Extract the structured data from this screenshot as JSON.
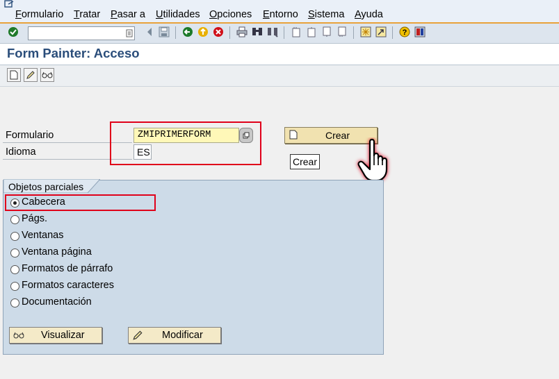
{
  "menu": {
    "items": [
      "Formulario",
      "Tratar",
      "Pasar a",
      "Utilidades",
      "Opciones",
      "Entorno",
      "Sistema",
      "Ayuda"
    ],
    "underline": [
      "F",
      "T",
      "P",
      "U",
      "O",
      "E",
      "S",
      "A"
    ]
  },
  "toolbar": {
    "command_value": ""
  },
  "page_title": "Form Painter: Acceso",
  "fields": {
    "form_label": "Formulario",
    "form_value": "ZMIPRIMERFORM",
    "lang_label": "Idioma",
    "lang_value": "ES"
  },
  "create_button": {
    "label": "Crear",
    "tooltip": "Crear"
  },
  "group": {
    "title": "Objetos parciales",
    "options": [
      "Cabecera",
      "Págs.",
      "Ventanas",
      "Ventana página",
      "Formatos de párrafo",
      "Formatos caracteres",
      "Documentación"
    ],
    "selected_index": 0
  },
  "buttons": {
    "display": "Visualizar",
    "change": "Modificar"
  },
  "colors": {
    "title": "#2a4d7a",
    "highlight": "#e0001a",
    "field": "#fff8b8",
    "menu_accent": "#e8a23a"
  }
}
